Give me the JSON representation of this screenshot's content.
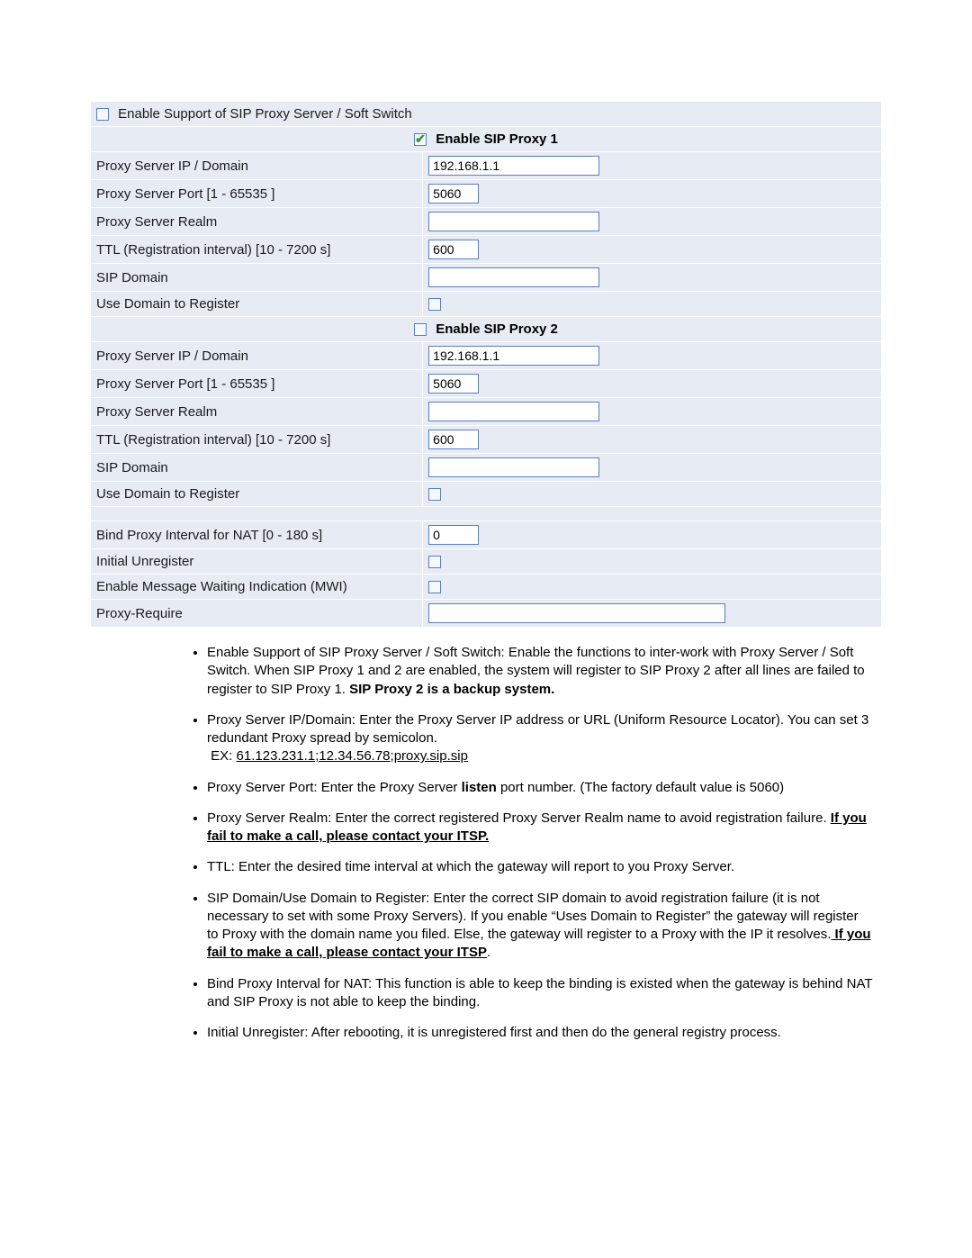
{
  "table": {
    "enable_support": {
      "label": "Enable Support of SIP Proxy Server / Soft Switch",
      "checked": false
    },
    "proxy1_header": {
      "label": "Enable SIP Proxy 1",
      "checked": true
    },
    "proxy2_header": {
      "label": "Enable SIP Proxy 2",
      "checked": false
    },
    "rows": {
      "ip": {
        "label": "Proxy Server IP / Domain",
        "value": "192.168.1.1"
      },
      "port": {
        "label": "Proxy Server Port [1 - 65535 ]",
        "value": "5060"
      },
      "realm": {
        "label": "Proxy Server Realm",
        "value": ""
      },
      "ttl": {
        "label": "TTL (Registration interval) [10 - 7200 s]",
        "value": "600"
      },
      "sipdomain": {
        "label": "SIP Domain",
        "value": ""
      },
      "usedomain": {
        "label": "Use Domain to Register",
        "checked": false
      }
    },
    "rows2": {
      "ip": {
        "value": "192.168.1.1"
      },
      "port": {
        "value": "5060"
      },
      "realm": {
        "value": ""
      },
      "ttl": {
        "value": "600"
      },
      "sipdomain": {
        "value": ""
      },
      "usedomain": {
        "checked": false
      }
    },
    "extra": {
      "bind": {
        "label": "Bind Proxy Interval for NAT [0 - 180 s]",
        "value": "0"
      },
      "unreg": {
        "label": "Initial Unregister",
        "checked": false
      },
      "mwi": {
        "label": "Enable Message Waiting Indication (MWI)",
        "checked": false
      },
      "proxyreq": {
        "label": "Proxy-Require",
        "value": ""
      }
    }
  },
  "notes": {
    "n1a": "Enable Support of SIP Proxy Server / Soft Switch: Enable the functions to inter-work with Proxy Server / Soft Switch. When SIP Proxy 1 and 2 are enabled, the system will register to SIP Proxy 2 after all lines are failed to register to SIP Proxy 1. ",
    "n1b": "SIP Proxy 2 is a backup system.",
    "n2a": "Proxy Server IP/Domain: Enter the Proxy Server IP address or URL (Uniform Resource Locator). You can set 3 redundant Proxy spread by semicolon.",
    "n2b": "EX: ",
    "n2c": "61.123.231.1;12.34.56.78;proxy.sip.sip",
    "n3a": "Proxy Server Port: Enter the Proxy Server ",
    "n3b": "listen",
    "n3c": " port number. (The factory default value is 5060)",
    "n4a": "Proxy Server Realm: Enter the correct registered Proxy Server Realm name to avoid registration failure. ",
    "n4b": "If you fail to make a call, please contact your ITSP.",
    "n5": "TTL: Enter the desired time interval at which the gateway will report to you Proxy Server.",
    "n6a": "SIP Domain/Use Domain to Register: Enter the correct SIP domain to avoid registration failure (it is not necessary to set with some Proxy Servers). If you enable “Uses Domain to Register” the gateway will register to Proxy with the domain name you filed. Else, the gateway will register to a Proxy with the IP it resolves.",
    "n6b": " If you fail to make a call, please contact your ITSP",
    "n7": "Bind Proxy Interval for NAT: This function is able to keep the binding is existed when the gateway is behind NAT and SIP Proxy is not able to keep the binding.",
    "n8": "Initial Unregister: After rebooting, it is unregistered first and then do the general registry process."
  }
}
